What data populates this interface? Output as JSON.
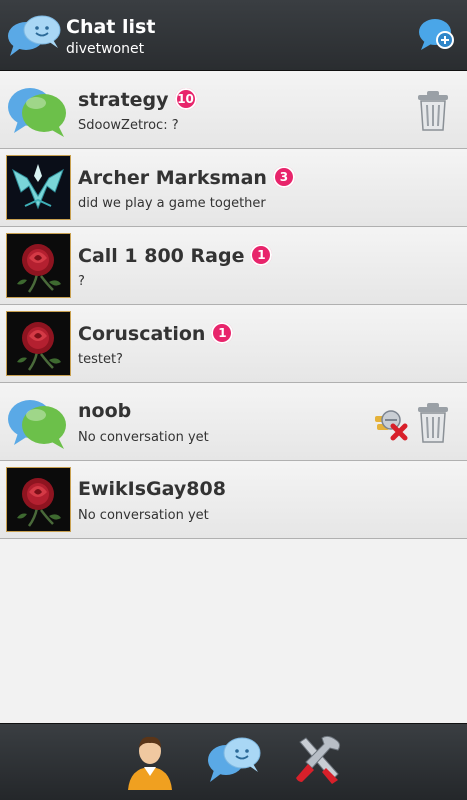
{
  "header": {
    "title": "Chat list",
    "subtitle": "divetwonet",
    "icon": "chat-bubbles-icon",
    "new_chat_icon": "new-chat-icon"
  },
  "chats": [
    {
      "name": "strategy",
      "badge": "10",
      "message": "SdoowZetroc: ?",
      "avatar": "group-chat-icon",
      "actions": [
        "delete"
      ]
    },
    {
      "name": "Archer Marksman",
      "badge": "3",
      "message": "did we play a game together",
      "avatar": "archer-emblem"
    },
    {
      "name": "Call 1 800 Rage",
      "badge": "1",
      "message": "?",
      "avatar": "rose-image"
    },
    {
      "name": "Coruscation",
      "badge": "1",
      "message": "testet?",
      "avatar": "rose-image"
    },
    {
      "name": "noob",
      "badge": "",
      "message": "No conversation yet",
      "avatar": "group-chat-icon",
      "actions": [
        "block",
        "delete"
      ]
    },
    {
      "name": "EwikIsGay808",
      "badge": "",
      "message": "No conversation yet",
      "avatar": "rose-image"
    }
  ],
  "bottom_bar": {
    "tabs": [
      "profile",
      "chat",
      "settings"
    ]
  },
  "colors": {
    "header_bg": "#2f3236",
    "badge": "#e8246b",
    "accent_blue": "#4aa6e8",
    "accent_green": "#6cc04a"
  }
}
